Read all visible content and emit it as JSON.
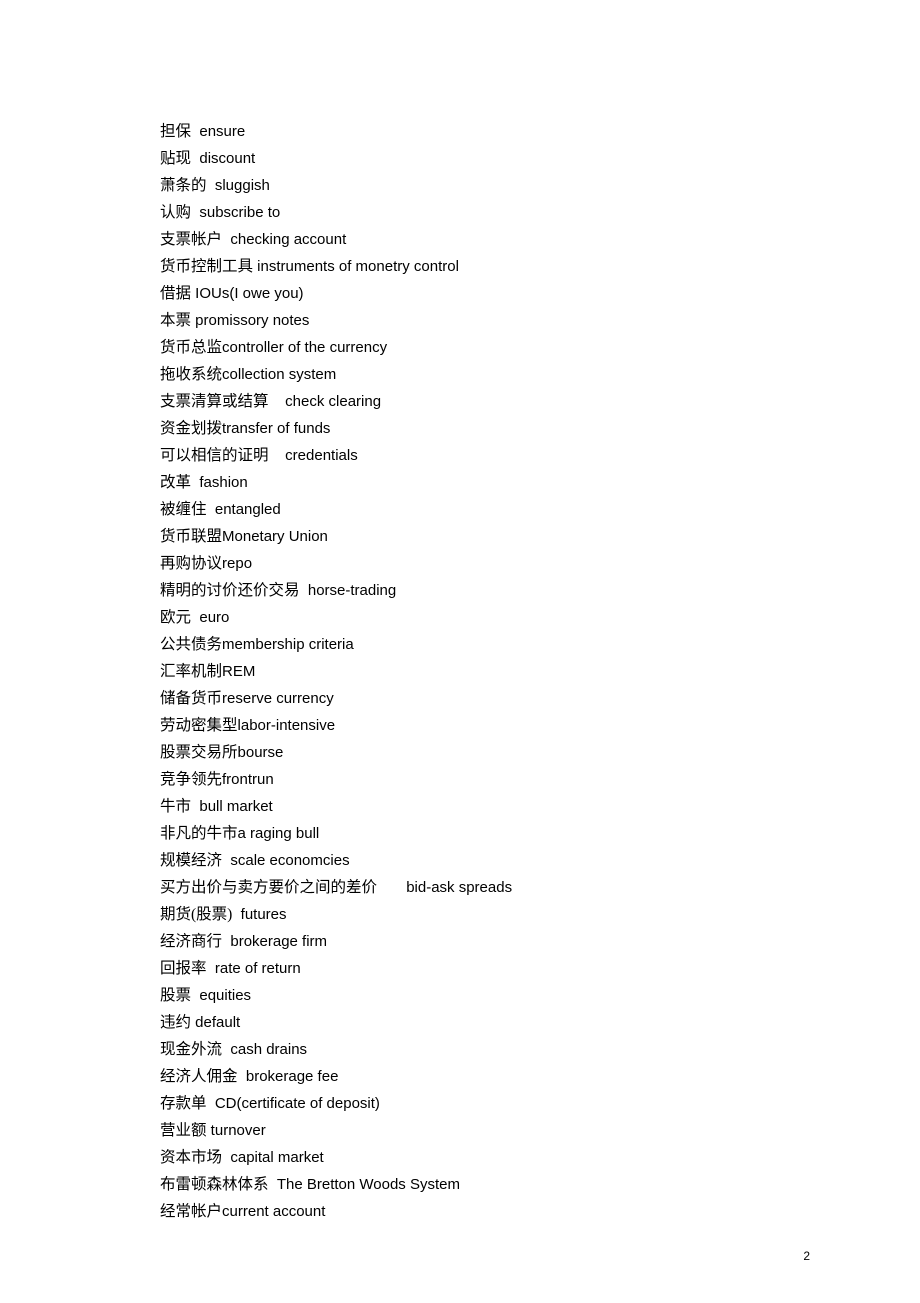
{
  "entries": [
    {
      "cn": "担保",
      "en": "  ensure"
    },
    {
      "cn": "贴现",
      "en": "  discount"
    },
    {
      "cn": "萧条的",
      "en": "  sluggish"
    },
    {
      "cn": "认购",
      "en": "  subscribe to"
    },
    {
      "cn": "支票帐户",
      "en": "  checking account"
    },
    {
      "cn": "货币控制工具",
      "en": " instruments of monetry control"
    },
    {
      "cn": "借据",
      "en": " IOUs(I owe you)"
    },
    {
      "cn": "本票",
      "en": " promissory notes"
    },
    {
      "cn": "货币总监",
      "en": "controller of the currency"
    },
    {
      "cn": "拖收系统",
      "en": "collection system"
    },
    {
      "cn": "支票清算或结算",
      "en": "    check clearing"
    },
    {
      "cn": "资金划拨",
      "en": "transfer of funds"
    },
    {
      "cn": "可以相信的证明",
      "en": "    credentials"
    },
    {
      "cn": "改革",
      "en": "  fashion"
    },
    {
      "cn": "被缠住",
      "en": "  entangled"
    },
    {
      "cn": "货币联盟",
      "en": "Monetary Union"
    },
    {
      "cn": "再购协议",
      "en": "repo"
    },
    {
      "cn": "精明的讨价还价交易",
      "en": "  horse-trading"
    },
    {
      "cn": "欧元",
      "en": "  euro"
    },
    {
      "cn": "公共债务",
      "en": "membership criteria"
    },
    {
      "cn": "汇率机制",
      "en": "REM"
    },
    {
      "cn": "储备货币",
      "en": "reserve currency"
    },
    {
      "cn": "劳动密集型",
      "en": "labor-intensive"
    },
    {
      "cn": "股票交易所",
      "en": "bourse"
    },
    {
      "cn": "竞争领先",
      "en": "frontrun"
    },
    {
      "cn": "牛市",
      "en": "  bull market"
    },
    {
      "cn": "非凡的牛市",
      "en": "a raging bull"
    },
    {
      "cn": "规模经济",
      "en": "  scale economcies"
    },
    {
      "cn": "买方出价与卖方要价之间的差价",
      "en": "       bid-ask spreads"
    },
    {
      "cn": "期货(股票)",
      "en": "  futures"
    },
    {
      "cn": "经济商行",
      "en": "  brokerage firm"
    },
    {
      "cn": "回报率",
      "en": "  rate of return"
    },
    {
      "cn": "股票",
      "en": "  equities"
    },
    {
      "cn": "违约",
      "en": " default"
    },
    {
      "cn": "现金外流",
      "en": "  cash drains"
    },
    {
      "cn": "经济人佣金",
      "en": "  brokerage fee"
    },
    {
      "cn": "存款单",
      "en": "  CD(certificate of deposit)"
    },
    {
      "cn": "营业额",
      "en": " turnover"
    },
    {
      "cn": "资本市场",
      "en": "  capital market"
    },
    {
      "cn": "布雷顿森林体系",
      "en": "  The Bretton Woods System"
    },
    {
      "cn": "经常帐户",
      "en": "current account"
    }
  ],
  "pageNumber": "2"
}
